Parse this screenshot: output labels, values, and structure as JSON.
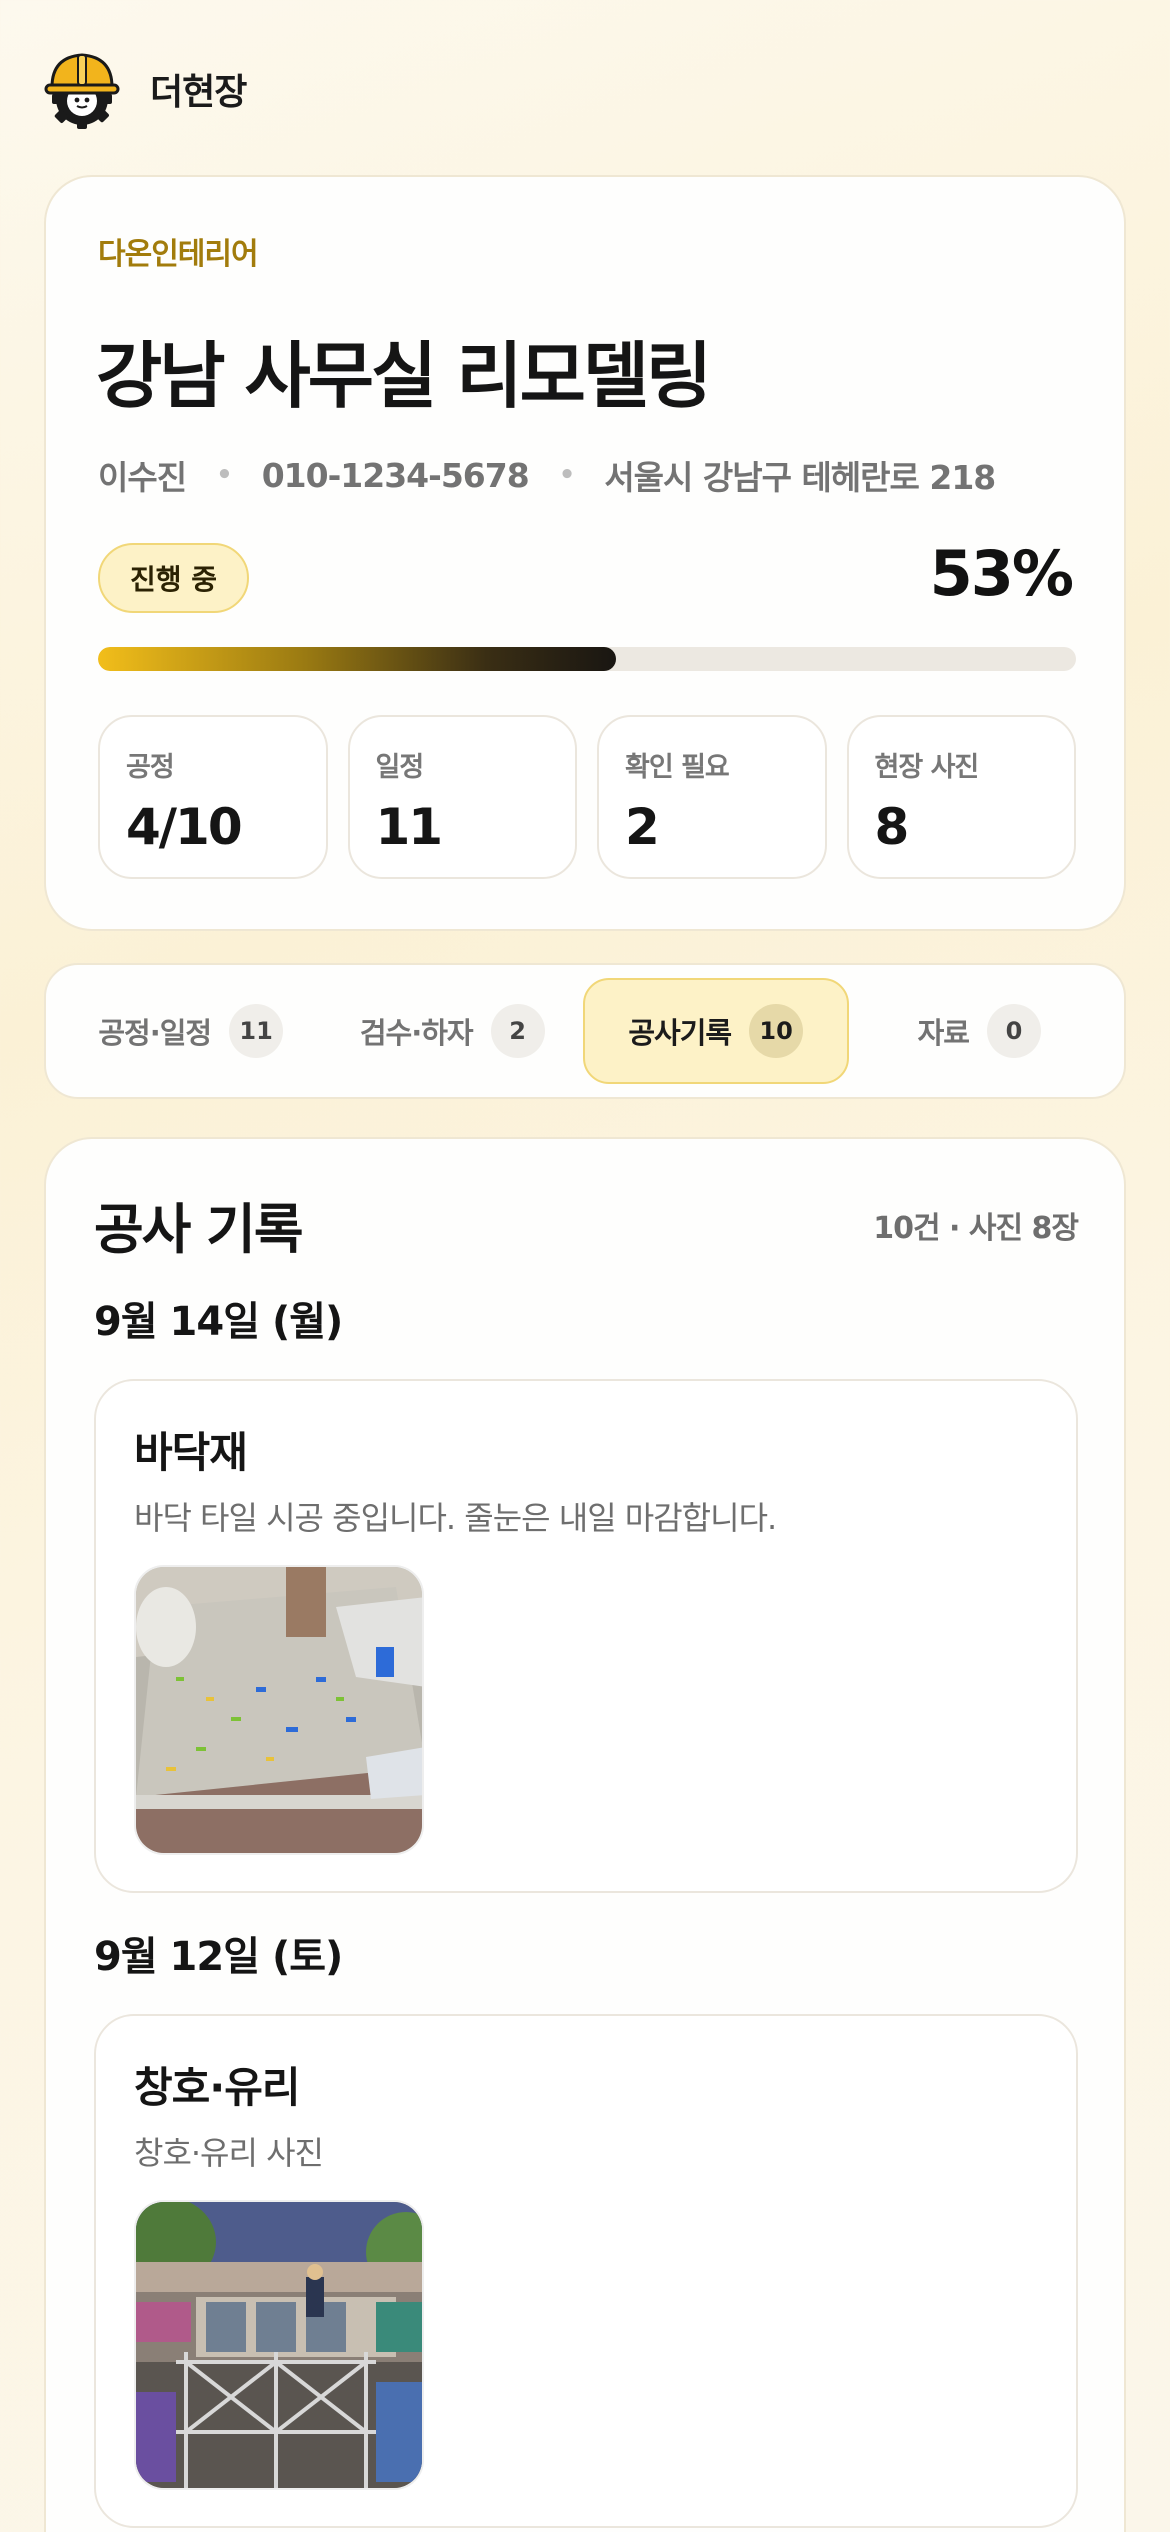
{
  "app": {
    "name": "더현장",
    "logo_icon": "hardhat-gear-icon"
  },
  "project": {
    "company": "다온인테리어",
    "title": "강남 사무실 리모델링",
    "manager": "이수진",
    "phone": "010-1234-5678",
    "address": "서울시 강남구 테헤란로 218",
    "status": "진행 중",
    "progress_label": "53%",
    "progress": 0.53,
    "stats": [
      {
        "label": "공정",
        "value": "4/10"
      },
      {
        "label": "일정",
        "value": "11"
      },
      {
        "label": "확인 필요",
        "value": "2"
      },
      {
        "label": "현장 사진",
        "value": "8"
      }
    ]
  },
  "tabs": [
    {
      "label": "공정·일정",
      "count": "11",
      "active": false
    },
    {
      "label": "검수·하자",
      "count": "2",
      "active": false
    },
    {
      "label": "공사기록",
      "count": "10",
      "active": true
    },
    {
      "label": "자료",
      "count": "0",
      "active": false
    }
  ],
  "records": {
    "title": "공사 기록",
    "summary": "10건 · 사진 8장",
    "groups": [
      {
        "date": "9월 14일 (월)",
        "item": {
          "title": "바닥재",
          "desc": "바닥 타일 시공 중입니다. 줄눈은 내일 마감합니다.",
          "photo": "floor-tile-photo"
        }
      },
      {
        "date": "9월 12일 (토)",
        "item": {
          "title": "창호·유리",
          "desc": "창호·유리 사진",
          "photo": "window-scaffold-photo"
        }
      }
    ]
  },
  "colors": {
    "accent": "#f2be1a",
    "brand_text": "#a27c0c",
    "badge_bg": "#fdf2c7"
  }
}
